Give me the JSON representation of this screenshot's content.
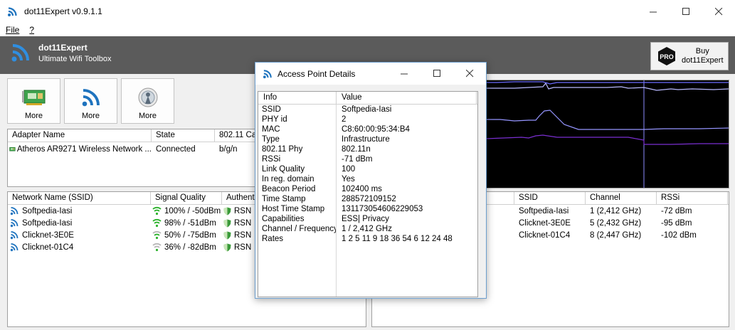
{
  "window": {
    "title": "dot11Expert v0.9.1.1"
  },
  "menu": {
    "items": [
      "File",
      "?"
    ]
  },
  "header": {
    "app_name": "dot11Expert",
    "subtitle": "Ultimate Wifi Toolbox",
    "buy_label_line1": "Buy",
    "buy_label_line2": "dot11Expert",
    "pro_badge": "PRO"
  },
  "toolbar": {
    "buttons": [
      {
        "label": "More",
        "icon": "network-card-icon"
      },
      {
        "label": "More",
        "icon": "wifi-icon"
      },
      {
        "label": "More",
        "icon": "access-point-icon"
      }
    ]
  },
  "adapters": {
    "columns": [
      "Adapter Name",
      "State",
      "802.11 Cap"
    ],
    "rows": [
      {
        "name": "Atheros AR9271 Wireless Network ...",
        "state": "Connected",
        "cap": "b/g/n"
      }
    ]
  },
  "networks": {
    "columns": [
      "Network Name (SSID)",
      "Signal Quality",
      "Authenti"
    ],
    "rows": [
      {
        "ssid": "Softpedia-Iasi",
        "signal": "100% / -50dBm",
        "auth": "RSN",
        "strength": "high"
      },
      {
        "ssid": "Softpedia-Iasi",
        "signal": "98% / -51dBm",
        "auth": "RSN",
        "strength": "high"
      },
      {
        "ssid": "Clicknet-3E0E",
        "signal": "50% / -75dBm",
        "auth": "RSN",
        "strength": "mid"
      },
      {
        "ssid": "Clicknet-01C4",
        "signal": "36% / -82dBm",
        "auth": "RSN",
        "strength": "low"
      }
    ]
  },
  "ap_list": {
    "columns": [
      "",
      "SSID",
      "Channel",
      "RSSi"
    ],
    "rows": [
      {
        "ssid": "Softpedia-Iasi",
        "channel": "1 (2,412 GHz)",
        "rssi": "-72 dBm"
      },
      {
        "ssid": "Clicknet-3E0E",
        "channel": "5 (2,432 GHz)",
        "rssi": "-95 dBm"
      },
      {
        "ssid": "Clicknet-01C4",
        "channel": "8 (2,447 GHz)",
        "rssi": "-102 dBm"
      }
    ]
  },
  "graph": {
    "colors": {
      "grid": "#5a5a5a",
      "series_a": "#8c8cff",
      "series_b": "#b9b9ff",
      "series_c": "#7a2fd1",
      "background": "#000000"
    }
  },
  "dialog": {
    "title": "Access Point Details",
    "columns": [
      "Info",
      "Value"
    ],
    "rows": [
      {
        "k": "SSID",
        "v": "Softpedia-Iasi"
      },
      {
        "k": "PHY id",
        "v": "2"
      },
      {
        "k": "MAC",
        "v": "C8:60:00:95:34:B4"
      },
      {
        "k": "Type",
        "v": "Infrastructure"
      },
      {
        "k": "802.11 Phy",
        "v": "802.11n"
      },
      {
        "k": "RSSi",
        "v": "-71 dBm"
      },
      {
        "k": "Link Quality",
        "v": "100"
      },
      {
        "k": "In reg. domain",
        "v": "Yes"
      },
      {
        "k": "Beacon Period",
        "v": "102400 ms"
      },
      {
        "k": "Time Stamp",
        "v": "288572109152"
      },
      {
        "k": "Host Time Stamp",
        "v": "131173054606229053"
      },
      {
        "k": "Capabilities",
        "v": "ESS| Privacy"
      },
      {
        "k": "Channel / Frequency",
        "v": "1 / 2,412 GHz"
      },
      {
        "k": "Rates",
        "v": "1 2 5 11 9 18 36 54 6 12 24 48"
      }
    ]
  },
  "colors": {
    "accent": "#1e73be",
    "header_bg": "#5b5b5b",
    "shield_green": "#3a9a3a",
    "signal_green": "#2db22d"
  }
}
